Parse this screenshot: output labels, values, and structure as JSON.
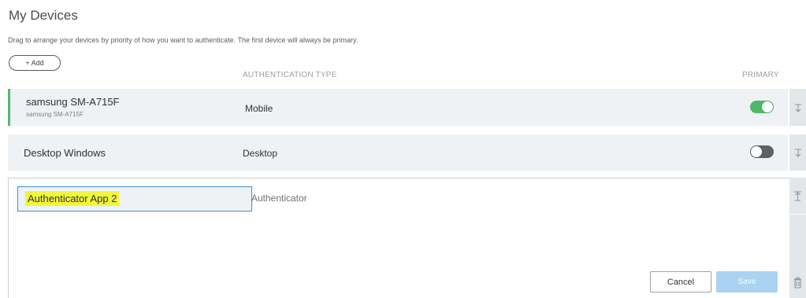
{
  "page": {
    "title": "My Devices",
    "subtitle": "Drag to arrange your devices by priority of how you want to authenticate. The first device will always be primary."
  },
  "toolbar": {
    "add_label": "+ Add"
  },
  "columns": {
    "auth_type": "AUTHENTICATION TYPE",
    "primary": "PRIMARY"
  },
  "devices": [
    {
      "name": "samsung SM-A715F",
      "sub": "samsung SM-A715F",
      "type": "Mobile",
      "primary": true
    },
    {
      "name": "Desktop Windows",
      "sub": "",
      "type": "Desktop",
      "primary": false
    }
  ],
  "edit": {
    "input_value": "Authenticator App 2",
    "type": "Authenticator",
    "cancel_label": "Cancel",
    "save_label": "Save"
  },
  "icons": {
    "drag_down": "move-down-icon",
    "drag_up": "move-up-icon",
    "delete": "trash-icon"
  },
  "colors": {
    "accent_green": "#4cb868",
    "input_border": "#3d90d5",
    "highlight": "#f3f53a",
    "save_disabled": "#a9d3f0"
  }
}
